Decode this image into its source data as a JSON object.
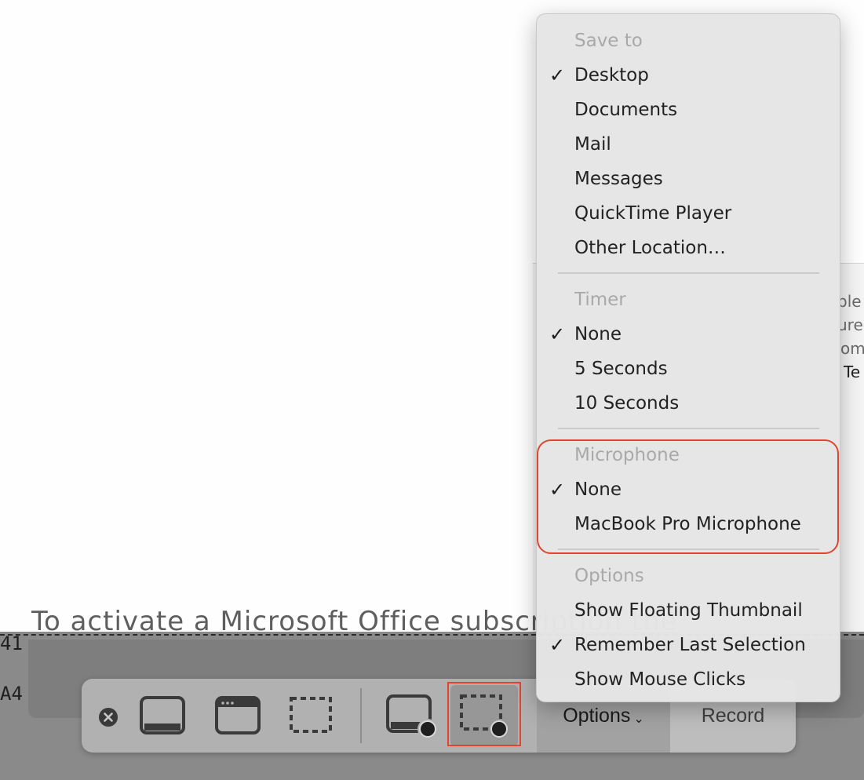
{
  "background": {
    "cut_text": "To activate a Microsoft Office subscription the",
    "side_fragments": [
      "41",
      "A4"
    ],
    "right_fragments": [
      "ble",
      "ured",
      "om",
      "Te"
    ]
  },
  "toolbar": {
    "close_icon": "close-circle-icon",
    "capture_entire_screen_icon": "capture-entire-screen-icon",
    "capture_window_icon": "capture-window-icon",
    "capture_selection_icon": "capture-selection-icon",
    "record_entire_screen_icon": "record-entire-screen-icon",
    "record_selection_icon": "record-selection-icon",
    "options_label": "Options",
    "options_chevron": "⌄",
    "record_label": "Record",
    "accent_highlight": "#e0452f"
  },
  "menu": {
    "check_glyph": "✓",
    "save_to": {
      "header": "Save to",
      "items": [
        {
          "label": "Desktop",
          "checked": true
        },
        {
          "label": "Documents",
          "checked": false
        },
        {
          "label": "Mail",
          "checked": false
        },
        {
          "label": "Messages",
          "checked": false
        },
        {
          "label": "QuickTime Player",
          "checked": false
        },
        {
          "label": "Other Location…",
          "checked": false
        }
      ]
    },
    "timer": {
      "header": "Timer",
      "items": [
        {
          "label": "None",
          "checked": true
        },
        {
          "label": "5 Seconds",
          "checked": false
        },
        {
          "label": "10 Seconds",
          "checked": false
        }
      ]
    },
    "microphone": {
      "header": "Microphone",
      "items": [
        {
          "label": "None",
          "checked": true
        },
        {
          "label": "MacBook Pro Microphone",
          "checked": false
        }
      ]
    },
    "options": {
      "header": "Options",
      "items": [
        {
          "label": "Show Floating Thumbnail",
          "checked": false
        },
        {
          "label": "Remember Last Selection",
          "checked": true
        },
        {
          "label": "Show Mouse Clicks",
          "checked": false
        }
      ]
    }
  }
}
